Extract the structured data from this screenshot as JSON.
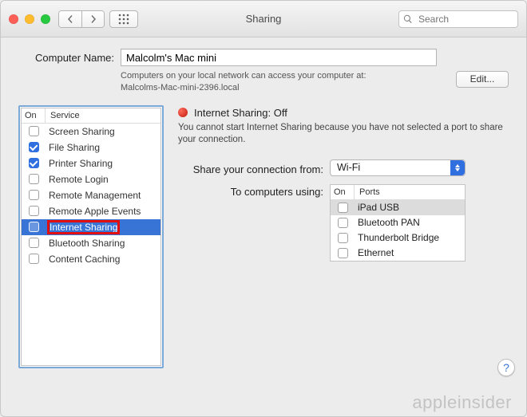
{
  "window": {
    "title": "Sharing",
    "search_placeholder": "Search"
  },
  "computer_name": {
    "label": "Computer Name:",
    "value": "Malcolm's Mac mini",
    "subtext_line1": "Computers on your local network can access your computer at:",
    "subtext_line2": "Malcolms-Mac-mini-2396.local",
    "edit_button": "Edit..."
  },
  "services": {
    "header_on": "On",
    "header_service": "Service",
    "items": [
      {
        "checked": false,
        "label": "Screen Sharing",
        "selected": false,
        "highlighted": false
      },
      {
        "checked": true,
        "label": "File Sharing",
        "selected": false,
        "highlighted": false
      },
      {
        "checked": true,
        "label": "Printer Sharing",
        "selected": false,
        "highlighted": false
      },
      {
        "checked": false,
        "label": "Remote Login",
        "selected": false,
        "highlighted": false
      },
      {
        "checked": false,
        "label": "Remote Management",
        "selected": false,
        "highlighted": false
      },
      {
        "checked": false,
        "label": "Remote Apple Events",
        "selected": false,
        "highlighted": false
      },
      {
        "checked": false,
        "label": "Internet Sharing",
        "selected": true,
        "highlighted": true
      },
      {
        "checked": false,
        "label": "Bluetooth Sharing",
        "selected": false,
        "highlighted": false
      },
      {
        "checked": false,
        "label": "Content Caching",
        "selected": false,
        "highlighted": false
      }
    ]
  },
  "detail": {
    "status_color": "red",
    "status_title": "Internet Sharing: Off",
    "status_desc": "You cannot start Internet Sharing because you have not selected a port to share your connection.",
    "share_from_label": "Share your connection from:",
    "share_from_value": "Wi-Fi",
    "to_label": "To computers using:",
    "ports_header_on": "On",
    "ports_header_ports": "Ports",
    "ports": [
      {
        "checked": false,
        "label": "iPad USB",
        "selected": true
      },
      {
        "checked": false,
        "label": "Bluetooth PAN",
        "selected": false
      },
      {
        "checked": false,
        "label": "Thunderbolt Bridge",
        "selected": false
      },
      {
        "checked": false,
        "label": "Ethernet",
        "selected": false
      }
    ]
  },
  "help_button": "?",
  "watermark": "appleinsider"
}
